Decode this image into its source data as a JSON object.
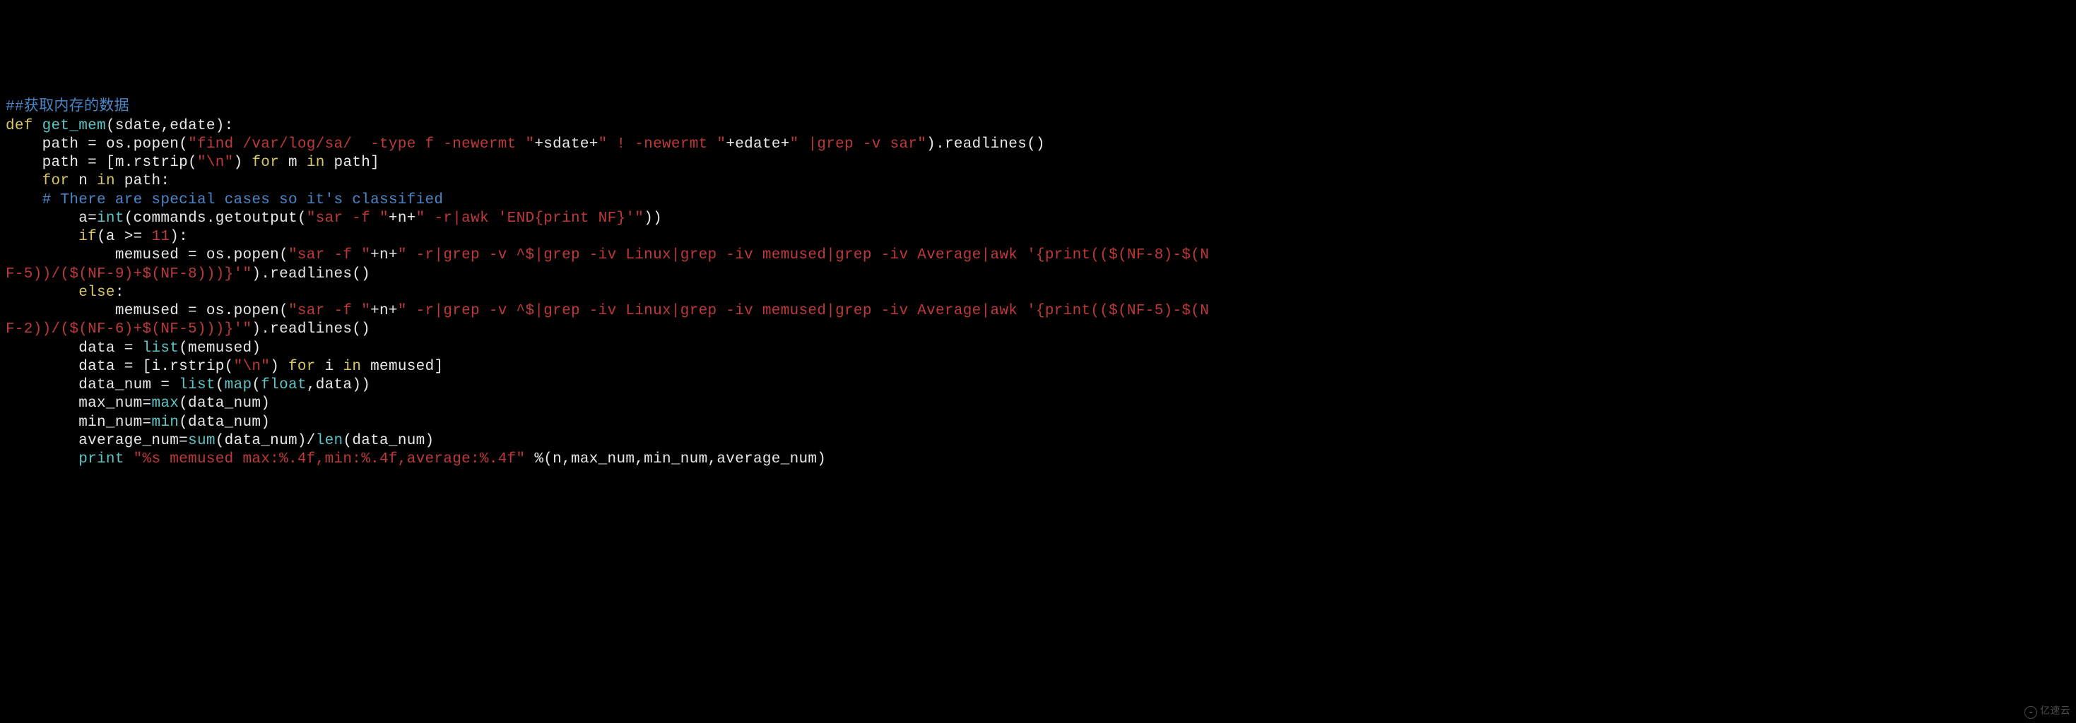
{
  "code": {
    "line01_comment": "##获取内存的数据",
    "line02_def": "def ",
    "line02_func": "get_mem",
    "line02_params": "(sdate,edate):",
    "line03_indent": "    path ",
    "line03_eq": "= ",
    "line03_os": "os.popen(",
    "line03_str": "\"find /var/log/sa/  -type f -newermt \"",
    "line03_plus1": "+sdate+",
    "line03_str2": "\" ! -newermt \"",
    "line03_plus2": "+edate+",
    "line03_str3": "\" |grep -v sar\"",
    "line03_end": ").readlines()",
    "line04_indent": "    path ",
    "line04_eq": "= ",
    "line04_bracket": "[m.rstrip(",
    "line04_str": "\"\\n\"",
    "line04_close": ") ",
    "line04_for": "for",
    "line04_m": " m ",
    "line04_in": "in",
    "line04_path": " path]",
    "line05_indent": "    ",
    "line05_for": "for",
    "line05_n": " n ",
    "line05_in": "in",
    "line05_path": " path:",
    "line06_indent": "    ",
    "line06_comment": "# There are special cases so it's classified",
    "line07_indent": "        a",
    "line07_eq": "=",
    "line07_int": "int",
    "line07_open": "(commands.getoutput(",
    "line07_str1": "\"sar -f \"",
    "line07_plus": "+n+",
    "line07_str2": "\" -r|awk 'END{print NF}'\"",
    "line07_close": "))",
    "line08_indent": "        ",
    "line08_if": "if",
    "line08_cond": "(a ",
    "line08_op": ">= ",
    "line08_num": "11",
    "line08_close": "):",
    "line09_indent": "            memused ",
    "line09_eq": "= ",
    "line09_os": "os.popen(",
    "line09_str1": "\"sar -f \"",
    "line09_plus": "+n+",
    "line09_str2": "\" -r|grep -v ^$|grep -iv Linux|grep -iv memused|grep -iv Average|awk '{print(($(NF-8)-$(N",
    "line10_str": "F-5))/($(NF-9)+$(NF-8)))}'\"",
    "line10_close": ").readlines()",
    "line11_indent": "        ",
    "line11_else": "else",
    "line11_colon": ":",
    "line12_indent": "            memused ",
    "line12_eq": "= ",
    "line12_os": "os.popen(",
    "line12_str1": "\"sar -f \"",
    "line12_plus": "+n+",
    "line12_str2": "\" -r|grep -v ^$|grep -iv Linux|grep -iv memused|grep -iv Average|awk '{print(($(NF-5)-$(N",
    "line13_str": "F-2))/($(NF-6)+$(NF-5)))}'\"",
    "line13_close": ").readlines()",
    "line14_indent": "        data ",
    "line14_eq": "= ",
    "line14_list": "list",
    "line14_arg": "(memused)",
    "line15_indent": "        data ",
    "line15_eq": "= ",
    "line15_bracket": "[i.rstrip(",
    "line15_str": "\"\\n\"",
    "line15_close": ") ",
    "line15_for": "for",
    "line15_i": " i ",
    "line15_in": "in",
    "line15_memused": " memused]",
    "line16_indent": "        data_num ",
    "line16_eq": "= ",
    "line16_list": "list",
    "line16_open": "(",
    "line16_map": "map",
    "line16_open2": "(",
    "line16_float": "float",
    "line16_close": ",data))",
    "line17_indent": "        max_num",
    "line17_eq": "=",
    "line17_max": "max",
    "line17_arg": "(data_num)",
    "line18_indent": "        min_num",
    "line18_eq": "=",
    "line18_min": "min",
    "line18_arg": "(data_num)",
    "line19_indent": "        average_num",
    "line19_eq": "=",
    "line19_sum": "sum",
    "line19_arg1": "(data_num)/",
    "line19_len": "len",
    "line19_arg2": "(data_num)",
    "line20_indent": "        ",
    "line20_print": "print ",
    "line20_str": "\"%s memused max:%.4f,min:%.4f,average:%.4f\"",
    "line20_args": " %(n,max_num,min_num,average_num)"
  },
  "watermark": {
    "text": "亿速云",
    "logo": "☁"
  }
}
